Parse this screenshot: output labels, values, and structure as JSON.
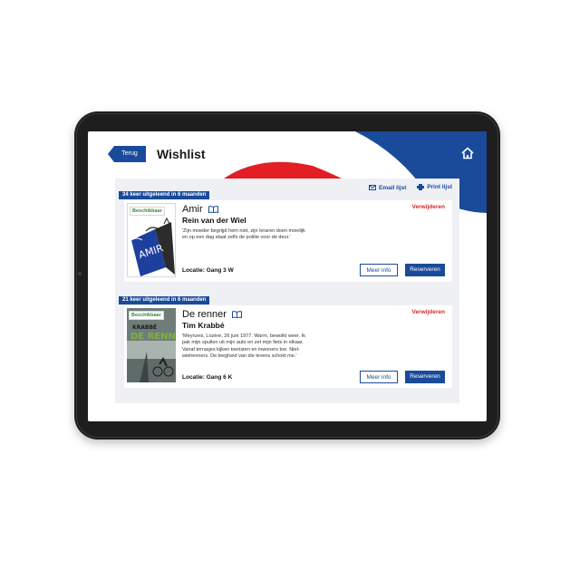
{
  "page": {
    "back_label": "Terug",
    "title": "Wishlist"
  },
  "actions": {
    "email_label": "Email lijst",
    "print_label": "Print lijst"
  },
  "colors": {
    "brand_blue": "#1a4b9b",
    "brand_red": "#e31e24",
    "available_green": "#2f8a3a",
    "remove_red": "#d22a2a"
  },
  "items": [
    {
      "loans": "34 keer uitgeleend in 6 maanden",
      "availability": "Beschikbaar",
      "cover_text": "AMIR",
      "title": "Amir",
      "author": "Rein van der Wiel",
      "quote": "'Zijn moeder begrijpt hem niet, zijn leraren doen moeilijk en op een dag staat zelfs de politie voor de deur.'",
      "location": "Locatie: Gang 3 W",
      "remove_label": "Verwijderen",
      "info_label": "Meer info",
      "reserve_label": "Reserveren"
    },
    {
      "loans": "21 keer uitgeleend in 6 maanden",
      "availability": "Beschikbaar",
      "cover_author": "KRABBÉ",
      "cover_text": "DE RENNER",
      "title": "De renner",
      "author": "Tim Krabbé",
      "quote": "'Meyrueis, Lozère, 26 juni 1977. Warm, bewolkt weer. Ik pak mijn spullen uit mijn auto en zet mijn fiets in elkaar. Vanaf terrasjes kijken toeristen en inwoners toe. Niet-wielrenners. De leegheid van die levens schokt me.'",
      "location": "Locatie: Gang 6 K",
      "remove_label": "Verwijderen",
      "info_label": "Meer info",
      "reserve_label": "Reserveren"
    }
  ]
}
